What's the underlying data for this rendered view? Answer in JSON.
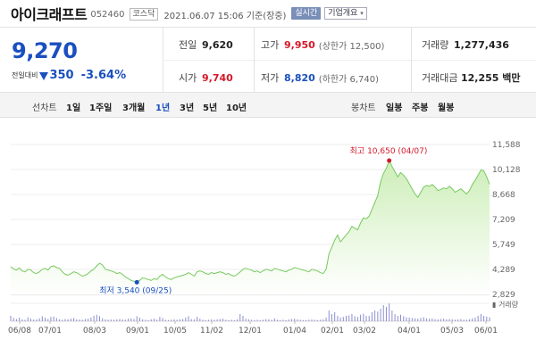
{
  "header": {
    "stock_name": "아이크래프트",
    "stock_code": "052460",
    "market": "코스닥",
    "timestamp": "2021.06.07 15:06 기준(장중)",
    "realtime_label": "실시간",
    "company_info_label": "기업개요"
  },
  "quote": {
    "current_price": "9,270",
    "change_label": "전일대비",
    "change_amount": "350",
    "change_percent": "-3.64%",
    "change_direction": "down",
    "prev_close_label": "전일",
    "prev_close": "9,620",
    "open_label": "시가",
    "open": "9,740",
    "high_label": "고가",
    "high": "9,950",
    "upper_limit": "(상한가 12,500)",
    "low_label": "저가",
    "low": "8,820",
    "lower_limit": "(하한가 6,740)",
    "volume_label": "거래량",
    "volume": "1,277,436",
    "amount_label": "거래대금",
    "amount": "12,255 백만"
  },
  "period_bar": {
    "line_chart_label": "선차트",
    "line_periods": [
      "1일",
      "1주일",
      "3개월",
      "1년",
      "3년",
      "5년",
      "10년"
    ],
    "active_period": "1년",
    "candle_chart_label": "봉차트",
    "candle_periods": [
      "일봉",
      "주봉",
      "월봉"
    ]
  },
  "chart_data": {
    "type": "area",
    "y_ticks": [
      "11,588",
      "10,128",
      "8,668",
      "7,209",
      "5,749",
      "4,289",
      "2,829"
    ],
    "ylim": [
      2829,
      11588
    ],
    "x_ticks": [
      "06/08",
      "07/01",
      "08/03",
      "09/01",
      "10/05",
      "11/02",
      "12/01",
      "01/04",
      "02/01",
      "03/02",
      "04/01",
      "05/03",
      "06/01"
    ],
    "high_annotation": "최고 10,650 (04/07)",
    "low_annotation": "최저 3,540 (09/25)",
    "volume_label": "거래량",
    "series": [
      {
        "values": [
          4450,
          4320,
          4250,
          4380,
          4200,
          4150,
          4300,
          4250,
          4100,
          4050,
          4150,
          4300,
          4350,
          4250,
          4450,
          4500,
          4400,
          4350,
          4150,
          4000,
          3950,
          4050,
          4150,
          4100,
          4000,
          3900,
          3950,
          4050,
          4200,
          4300,
          4500,
          4650,
          4550,
          4300,
          4250,
          4200,
          4150,
          4050,
          4100,
          4000,
          3850,
          3750,
          3650,
          3600,
          3540,
          3650,
          3800,
          3750,
          3700,
          3650,
          3750,
          3700,
          3900,
          4000,
          3850,
          3750,
          3700,
          3800,
          3850,
          3900,
          3950,
          4000,
          4100,
          4000,
          3900,
          4150,
          4200,
          4150,
          4050,
          4000,
          4100,
          4050,
          4100,
          4150,
          4100,
          4000,
          4050,
          3950,
          3900,
          4000,
          4150,
          4300,
          4350,
          4300,
          4250,
          4150,
          4200,
          4100,
          4200,
          4300,
          4250,
          4200,
          4350,
          4300,
          4250,
          4200,
          4150,
          4250,
          4300,
          4400,
          4350,
          4300,
          4250,
          4200,
          4150,
          4300,
          4250,
          4200,
          4100,
          4050,
          4300,
          5200,
          5600,
          6000,
          6300,
          5900,
          6100,
          6300,
          6500,
          6800,
          6700,
          6600,
          7000,
          7300,
          7250,
          7400,
          7800,
          8200,
          8600,
          9400,
          9900,
          10200,
          10650,
          10300,
          10000,
          9700,
          9950,
          9800,
          9600,
          9300,
          9000,
          8700,
          8500,
          8800,
          9100,
          9200,
          9150,
          9250,
          9100,
          8900,
          8950,
          9050,
          9000,
          9150,
          9000,
          8800,
          8900,
          9000,
          8850,
          8700,
          8900,
          9250,
          9500,
          9800,
          10100,
          10050,
          9700,
          9270
        ]
      }
    ],
    "volume_values": [
      30,
      18,
      12,
      20,
      10,
      8,
      22,
      14,
      9,
      10,
      16,
      28,
      20,
      12,
      24,
      26,
      18,
      10,
      8,
      12,
      10,
      14,
      18,
      10,
      9,
      8,
      12,
      14,
      20,
      30,
      36,
      28,
      16,
      10,
      8,
      9,
      8,
      10,
      12,
      10,
      8,
      14,
      16,
      12,
      28,
      20,
      10,
      8,
      6,
      10,
      14,
      8,
      24,
      18,
      8,
      6,
      8,
      10,
      8,
      10,
      12,
      20,
      28,
      12,
      10,
      24,
      14,
      8,
      6,
      8,
      10,
      8,
      10,
      12,
      14,
      8,
      6,
      8,
      6,
      10,
      40,
      30,
      14,
      10,
      8,
      6,
      8,
      6,
      8,
      12,
      10,
      8,
      16,
      8,
      6,
      8,
      6,
      10,
      12,
      14,
      10,
      8,
      6,
      6,
      8,
      10,
      8,
      6,
      8,
      10,
      20,
      60,
      40,
      50,
      30,
      20,
      24,
      30,
      32,
      40,
      28,
      24,
      36,
      42,
      30,
      30,
      50,
      60,
      54,
      70,
      90,
      80,
      100,
      60,
      40,
      30,
      36,
      28,
      22,
      20,
      18,
      16,
      14,
      18,
      22,
      16,
      14,
      16,
      12,
      10,
      12,
      14,
      10,
      12,
      10,
      8,
      10,
      12,
      8,
      8,
      10,
      16,
      20,
      30,
      40,
      30,
      26,
      22
    ]
  },
  "colors": {
    "price_blue": "#1a4fc0",
    "price_red": "#d4182a",
    "line_green": "#76c95d",
    "area_fill_top": "#cdeeb8",
    "volume_bar": "#8c8fcf"
  }
}
